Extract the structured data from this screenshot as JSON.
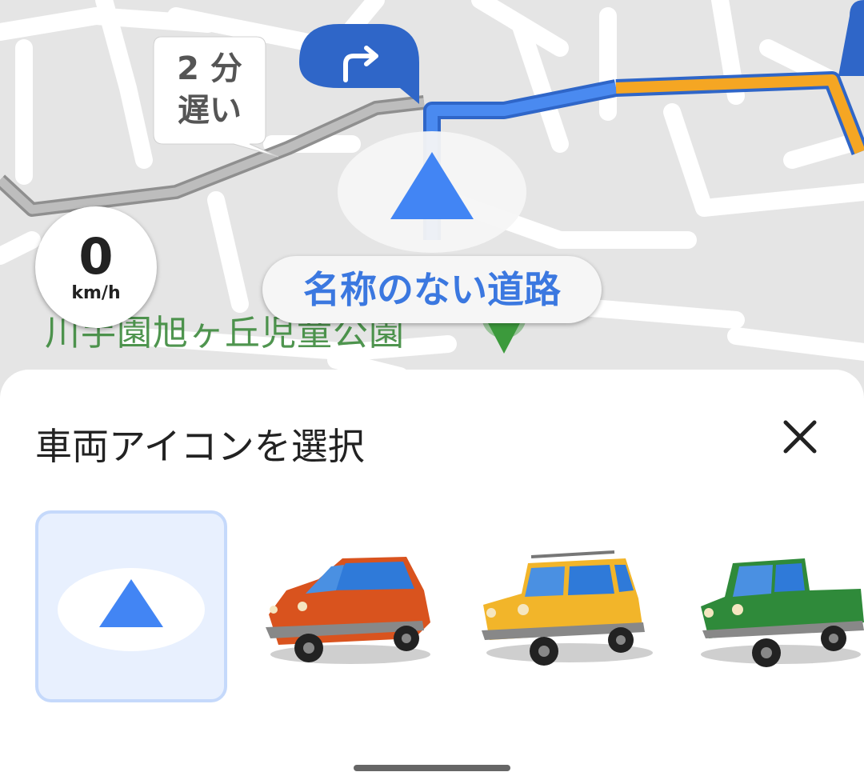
{
  "map": {
    "delay_label_line1": "2 分",
    "delay_label_line2": "遅い",
    "speed_value": "0",
    "speed_unit": "km/h",
    "road_name": "名称のない道路",
    "park_name": "川手園旭ヶ丘児童公園",
    "colors": {
      "route_blue": "#3b78e0",
      "route_orange": "#f5a623",
      "alt_route_gray": "#a9a9a9",
      "map_background": "#e5e5e5",
      "park_green": "#3c8a3c"
    },
    "turn_icon": "turn-right-icon"
  },
  "sheet": {
    "title": "車両アイコンを選択",
    "close_icon": "close-icon",
    "options": [
      {
        "icon": "navigation-arrow-icon",
        "selected": true
      },
      {
        "icon": "red-sedan-icon",
        "selected": false
      },
      {
        "icon": "yellow-suv-icon",
        "selected": false
      },
      {
        "icon": "green-pickup-truck-icon",
        "selected": false
      }
    ]
  }
}
